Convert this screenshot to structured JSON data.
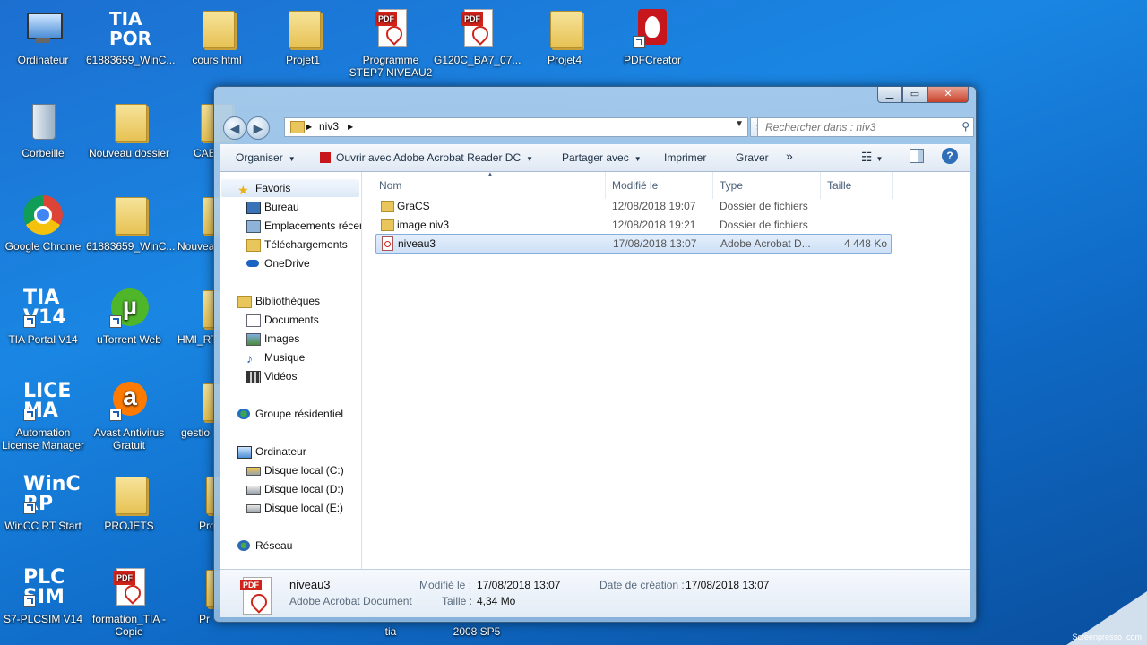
{
  "desktop": {
    "icons": [
      {
        "label": "Ordinateur",
        "kind": "computer-icon"
      },
      {
        "label": "61883659_WinC...",
        "kind": "tia-icon"
      },
      {
        "label": "cours html",
        "kind": "folder-icon"
      },
      {
        "label": "Projet1",
        "kind": "tia-folder-icon"
      },
      {
        "label": "Programme STEP7 NIVEAU2",
        "kind": "pdf-icon"
      },
      {
        "label": "G120C_BA7_07...",
        "kind": "pdf-icon"
      },
      {
        "label": "Projet4",
        "kind": "tia-folder-icon"
      },
      {
        "label": "PDFCreator",
        "kind": "pdfcreator-icon"
      },
      {
        "label": "Corbeille",
        "kind": "recycle-bin-icon"
      },
      {
        "label": "Nouveau dossier",
        "kind": "folder-icon"
      },
      {
        "label": "CAE",
        "kind": "folder-icon"
      },
      {
        "label": "Google Chrome",
        "kind": "chrome-icon"
      },
      {
        "label": "61883659_WinC...",
        "kind": "tia-folder-icon"
      },
      {
        "label": "Nouvea",
        "kind": "folder-icon"
      },
      {
        "label": "TIA Portal V14",
        "kind": "tia-portal-icon"
      },
      {
        "label": "uTorrent Web",
        "kind": "utorrent-icon"
      },
      {
        "label": "HMI_RT",
        "kind": "folder-icon"
      },
      {
        "label": "Automation License Manager",
        "kind": "license-icon"
      },
      {
        "label": "Avast Antivirus Gratuit",
        "kind": "avast-icon"
      },
      {
        "label": "gestio",
        "kind": "folder-icon"
      },
      {
        "label": "WinCC RT Start",
        "kind": "wincc-icon"
      },
      {
        "label": "PROJETS",
        "kind": "folder-icon"
      },
      {
        "label": "Pro",
        "kind": "folder-icon"
      },
      {
        "label": "S7-PLCSIM V14",
        "kind": "plcsim-icon"
      },
      {
        "label": "formation_TIA - Copie",
        "kind": "pdf-icon"
      },
      {
        "label": "Pr",
        "kind": "folder-icon"
      }
    ],
    "bottom_labels": [
      "tia",
      "2008 SP5"
    ],
    "watermark": "Screenpresso .com"
  },
  "window": {
    "controls": {
      "minimize": "▁",
      "maximize": "▭",
      "close": "✕"
    },
    "address": {
      "crumb": "niv3"
    },
    "search_placeholder": "Rechercher dans : niv3",
    "toolbar": {
      "organize": "Organiser",
      "open_with": "Ouvrir avec Adobe Acrobat Reader DC",
      "share": "Partager avec",
      "print": "Imprimer",
      "burn": "Graver",
      "more": "»"
    },
    "nav": {
      "favorites": "Favoris",
      "fav_items": [
        "Bureau",
        "Emplacements récer",
        "Téléchargements",
        "OneDrive"
      ],
      "libraries": "Bibliothèques",
      "lib_items": [
        "Documents",
        "Images",
        "Musique",
        "Vidéos"
      ],
      "homegroup": "Groupe résidentiel",
      "computer": "Ordinateur",
      "drives": [
        "Disque local (C:)",
        "Disque local (D:)",
        "Disque local (E:)"
      ],
      "network": "Réseau"
    },
    "columns": {
      "name": "Nom",
      "modified": "Modifié le",
      "type": "Type",
      "size": "Taille"
    },
    "files": [
      {
        "name": "GraCS",
        "date": "12/08/2018 19:07",
        "type": "Dossier de fichiers",
        "size": "",
        "kind": "folder"
      },
      {
        "name": "image niv3",
        "date": "12/08/2018 19:21",
        "type": "Dossier de fichiers",
        "size": "",
        "kind": "folder"
      },
      {
        "name": "niveau3",
        "date": "17/08/2018 13:07",
        "type": "Adobe Acrobat D...",
        "size": "4 448 Ko",
        "kind": "pdf"
      }
    ],
    "details": {
      "name": "niveau3",
      "type": "Adobe Acrobat Document",
      "modified_label": "Modifié le :",
      "modified_value": "17/08/2018 13:07",
      "size_label": "Taille :",
      "size_value": "4,34 Mo",
      "created_label": "Date de création :",
      "created_value": "17/08/2018 13:07"
    }
  }
}
